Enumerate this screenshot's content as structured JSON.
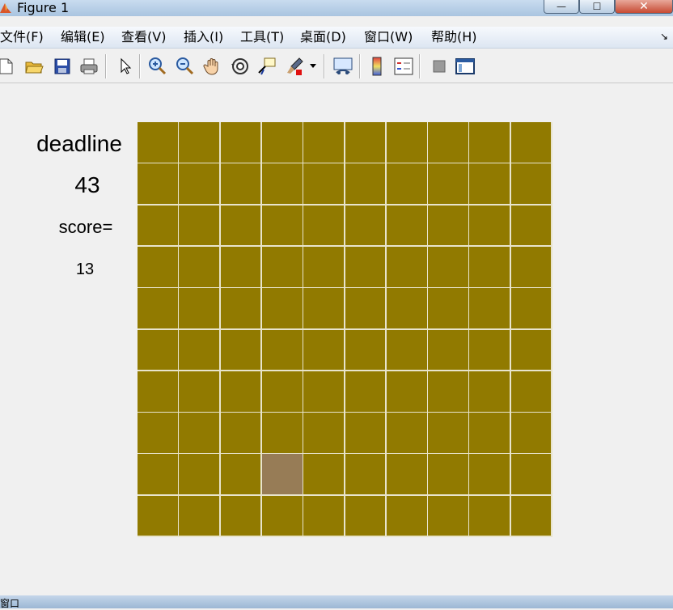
{
  "window": {
    "title": "Figure 1",
    "minimize_glyph": "—",
    "maximize_glyph": "☐",
    "close_glyph": "✕"
  },
  "menu": {
    "items": [
      "文件(F)",
      "编辑(E)",
      "查看(V)",
      "插入(I)",
      "工具(T)",
      "桌面(D)",
      "窗口(W)",
      "帮助(H)"
    ],
    "overflow_glyph": "↘"
  },
  "toolbar": {
    "buttons": [
      "new-file-icon",
      "open-folder-icon",
      "save-icon",
      "print-icon",
      "pointer-icon",
      "zoom-in-icon",
      "zoom-out-icon",
      "pan-hand-icon",
      "rotate-3d-icon",
      "data-cursor-icon",
      "brush-icon",
      "link-plot-icon",
      "colorbar-icon",
      "legend-icon",
      "hide-plot-tools-icon",
      "show-plot-tools-icon"
    ]
  },
  "figure": {
    "deadline_label": "deadline",
    "deadline_value": "43",
    "score_label": "score=",
    "score_value": "13"
  },
  "board": {
    "rows": 10,
    "cols": 10,
    "highlighted": {
      "row": 9,
      "col": 4
    },
    "colors": {
      "tile": "#917a00",
      "highlight": "#977c56",
      "gridline": "#e8e4cc"
    }
  },
  "statusbar": {
    "text": "窗口"
  }
}
